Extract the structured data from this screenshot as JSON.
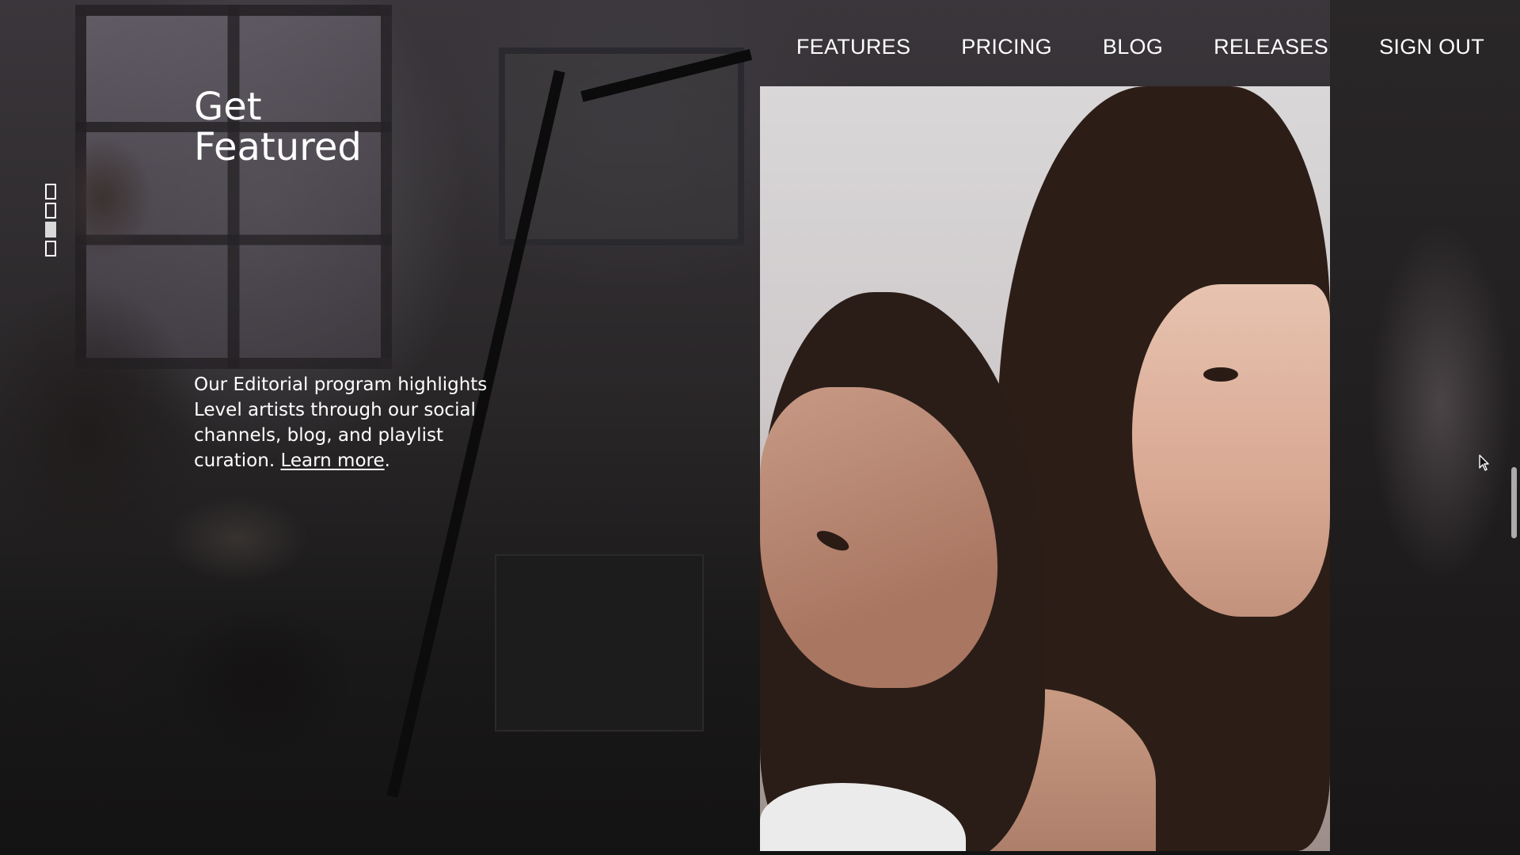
{
  "nav": {
    "items": [
      {
        "label": "FEATURES"
      },
      {
        "label": "PRICING"
      },
      {
        "label": "BLOG"
      },
      {
        "label": "RELEASES"
      },
      {
        "label": "SIGN OUT"
      }
    ]
  },
  "hero": {
    "title_line1": "Get",
    "title_line2": "Featured",
    "body": "Our Editorial program highlights Level artists through our social channels, blog, and playlist curation.",
    "link_label": "Learn more",
    "link_suffix": "."
  },
  "slides": {
    "count": 4,
    "active_index": 2
  },
  "colors": {
    "text": "#ffffff",
    "background": "#1c1a1b",
    "indicator_active": "#d9d9d9"
  },
  "icons": {
    "cursor": "mouse-pointer-icon"
  }
}
